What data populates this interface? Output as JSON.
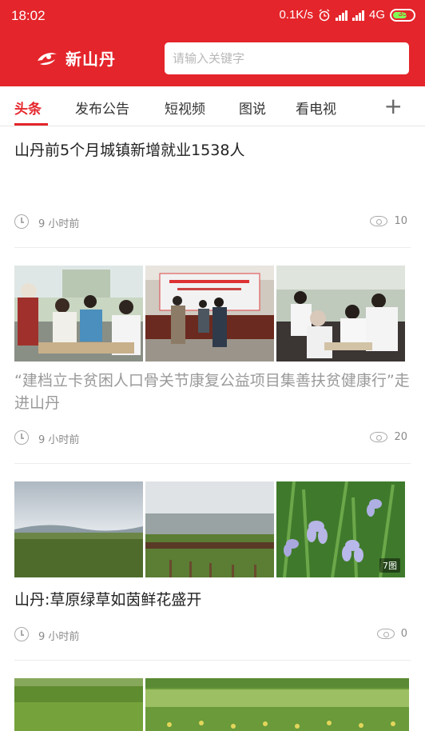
{
  "status_bar": {
    "time": "18:02",
    "network_speed": "0.1K/s",
    "network_type": "4G",
    "battery": "35",
    "icons": [
      "alarm-icon",
      "signal-icon",
      "signal-icon",
      "battery-icon"
    ]
  },
  "header": {
    "app_name": "新山丹",
    "search_placeholder": "请输入关键字"
  },
  "tabs": [
    {
      "label": "头条",
      "active": true
    },
    {
      "label": "发布公告",
      "active": false
    },
    {
      "label": "短视频",
      "active": false
    },
    {
      "label": "图说",
      "active": false
    },
    {
      "label": "看电视",
      "active": false
    }
  ],
  "tab_add_label": "+",
  "feed": [
    {
      "title": "山丹前5个月城镇新增就业1538人",
      "time": "9 小时前",
      "views": "10"
    },
    {
      "title": "“建档立卡贫困人口骨关节康复公益项目集善扶贫健康行”走进山丹",
      "time": "9 小时前",
      "views": "20",
      "images": [
        "crowd-photo",
        "meeting-photo",
        "medical-checkup-photo"
      ]
    },
    {
      "title": "山丹:草原绿草如茵鲜花盛开",
      "time": "9 小时前",
      "views": "0",
      "images": [
        "grassland-photo",
        "horses-grassland-photo",
        "iris-flowers-photo"
      ],
      "photo_count": "7图"
    },
    {
      "images": [
        "green-field-photo",
        "flower-field-photo"
      ]
    }
  ],
  "colors": {
    "brand_red": "#e4252b",
    "battery_green": "#7fff56",
    "text_dark": "#222222",
    "text_gray": "#9a9a9a"
  }
}
